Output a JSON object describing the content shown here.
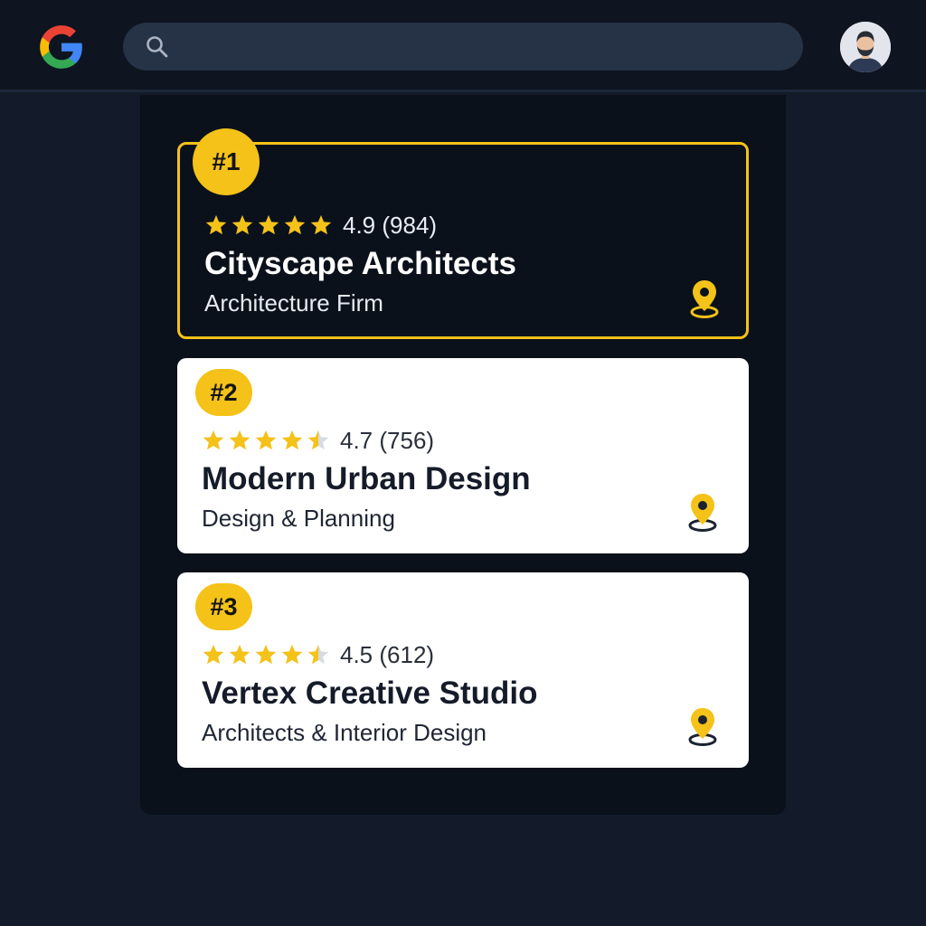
{
  "header": {
    "logo_icon": "google-g-logo-icon",
    "search": {
      "icon": "search-icon",
      "value": "",
      "placeholder": ""
    },
    "avatar_icon": "user-avatar-icon"
  },
  "colors": {
    "accent": "#f4c218",
    "background": "#131b2a",
    "topbar": "#0e1420",
    "panel": "#0b111b",
    "search_bg": "#263246",
    "card_light": "#ffffff"
  },
  "results": [
    {
      "rank": "#1",
      "rating_value": 4.9,
      "rating_text": "4.9 (984)",
      "name": "Cityscape Architects",
      "category": "Architecture Firm",
      "featured": true,
      "pin_icon": "location-pin-icon"
    },
    {
      "rank": "#2",
      "rating_value": 4.7,
      "rating_text": "4.7 (756)",
      "name": "Modern Urban Design",
      "category": "Design & Planning",
      "featured": false,
      "pin_icon": "location-pin-icon"
    },
    {
      "rank": "#3",
      "rating_value": 4.5,
      "rating_text": "4.5 (612)",
      "name": "Vertex Creative Studio",
      "category": "Architects & Interior Design",
      "featured": false,
      "pin_icon": "location-pin-icon"
    }
  ]
}
